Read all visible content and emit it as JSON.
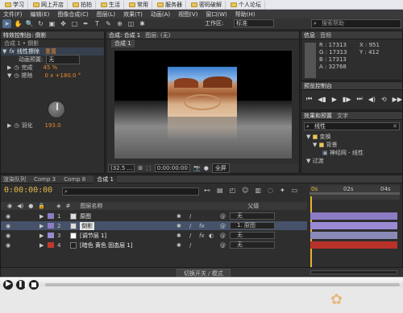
{
  "bookmarks": [
    "学习",
    "网上开店",
    "拍拍",
    "生活",
    "常用",
    "服务器",
    "密码破解",
    "个人论坛"
  ],
  "menu": [
    "文件(F)",
    "编辑(E)",
    "图像合成(C)",
    "图层(L)",
    "效果(T)",
    "动画(A)",
    "视图(V)",
    "窗口(W)",
    "帮助(H)"
  ],
  "toolbar": {
    "workspace_label": "工作区:",
    "workspace_value": "标准",
    "search_placeholder": "搜索帮助"
  },
  "fx_panel": {
    "title": "特效控制台: 倒影",
    "breadcrumb": "合成 1 • 倒影",
    "effect_name": "线性擦除",
    "reset": "重置",
    "preset_label": "动画预置:",
    "preset_value": "无",
    "complete_label": "完成",
    "complete_value": "45 %",
    "wipe_label": "擦除",
    "wipe_value": "0 x +180.0 °",
    "feather_label": "羽化",
    "feather_value": "193.0"
  },
  "viewer": {
    "tab_comp": "合成: 合成 1",
    "tab_layer": "图层: (无)",
    "subtab": "合成 1",
    "zoom": "(32.5 ...",
    "timecode": "0:00:00:00",
    "res": "全屏"
  },
  "info": {
    "tab_info": "信息",
    "tab_audio": "音频",
    "r": "R : 17313",
    "g": "G : 17313",
    "b": "B : 17313",
    "a": "A : 32768",
    "x": "X : 951",
    "y": "Y : 412"
  },
  "preview": {
    "title": "预览控制台"
  },
  "effects": {
    "tab": "效果和预置",
    "tab2": "文字",
    "search": "线性",
    "cat1": "变换",
    "cat2": "背景",
    "item": "神经网 - 线性",
    "cat3": "过渡"
  },
  "timeline": {
    "tabs": [
      "渲染队列",
      "Comp 3",
      "Comp 8",
      "合成 1"
    ],
    "timecode": "0:00:00:00",
    "col_source": "图层名称",
    "col_parent": "父级",
    "ruler": [
      "0s",
      "02s",
      "04s"
    ],
    "footer": "切换开关 / 模式",
    "layers": [
      {
        "num": "1",
        "name": "原图",
        "parent": "无",
        "color": "#8c7cc4"
      },
      {
        "num": "2",
        "name": "倒影",
        "parent": "1. 原图",
        "color": "#8c7cc4"
      },
      {
        "num": "3",
        "name": "[调节层 1]",
        "parent": "无",
        "color": "#9a8ad4"
      },
      {
        "num": "4",
        "name": "[暗色 黄色 固态层 1]",
        "parent": "无",
        "color": "#c0392b"
      }
    ]
  }
}
